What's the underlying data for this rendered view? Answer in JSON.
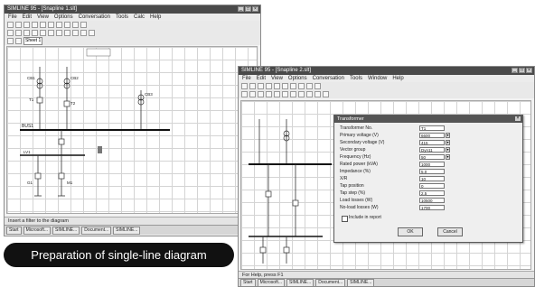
{
  "window1": {
    "title": "SIMLINE 95 - [Snapline 1.slt]",
    "menu": [
      "File",
      "Edit",
      "View",
      "Options",
      "Conversation",
      "Tools",
      "Calc",
      "Help"
    ],
    "status_text": "Insert a filter to the diagram",
    "taskbar_items": [
      "Start",
      "Microsoft...",
      "SIMLINE...",
      "Document...",
      "SIMLINE..."
    ],
    "tab_label": "Sheet 1",
    "bus_label": "BUS1",
    "device_labels": [
      "CB1",
      "CB2",
      "CB3",
      "T1",
      "T2",
      "LV1",
      "G1",
      "M1"
    ]
  },
  "window2": {
    "title": "SIMLINE 95 - [Snapline 2.slt]",
    "menu": [
      "File",
      "Edit",
      "View",
      "Options",
      "Conversation",
      "Tools",
      "Window",
      "Help"
    ],
    "status_text": "For Help, press F1",
    "taskbar_items": [
      "Start",
      "Microsoft...",
      "SIMLINE...",
      "Document...",
      "SIMLINE..."
    ],
    "dialog": {
      "title": "Transformer",
      "fields": [
        {
          "label": "Transformer No.",
          "value": "T1"
        },
        {
          "label": "Primary voltage (V)",
          "value": "6600"
        },
        {
          "label": "Secondary voltage (V)",
          "value": "415"
        },
        {
          "label": "Vector group",
          "value": "Dyn11"
        },
        {
          "label": "Frequency (Hz)",
          "value": "50"
        },
        {
          "label": "Rated power (kVA)",
          "value": "1000"
        },
        {
          "label": "Impedance (%)",
          "value": "5.0"
        },
        {
          "label": "X/R",
          "value": "10"
        },
        {
          "label": "Tap position",
          "value": "0"
        },
        {
          "label": "Tap step (%)",
          "value": "2.5"
        },
        {
          "label": "Load losses (W)",
          "value": "10500"
        },
        {
          "label": "No-load losses (W)",
          "value": "1700"
        }
      ],
      "checkbox_label": "Include in report",
      "ok_label": "OK",
      "cancel_label": "Cancel"
    }
  },
  "caption": "Preparation of single-line diagram"
}
